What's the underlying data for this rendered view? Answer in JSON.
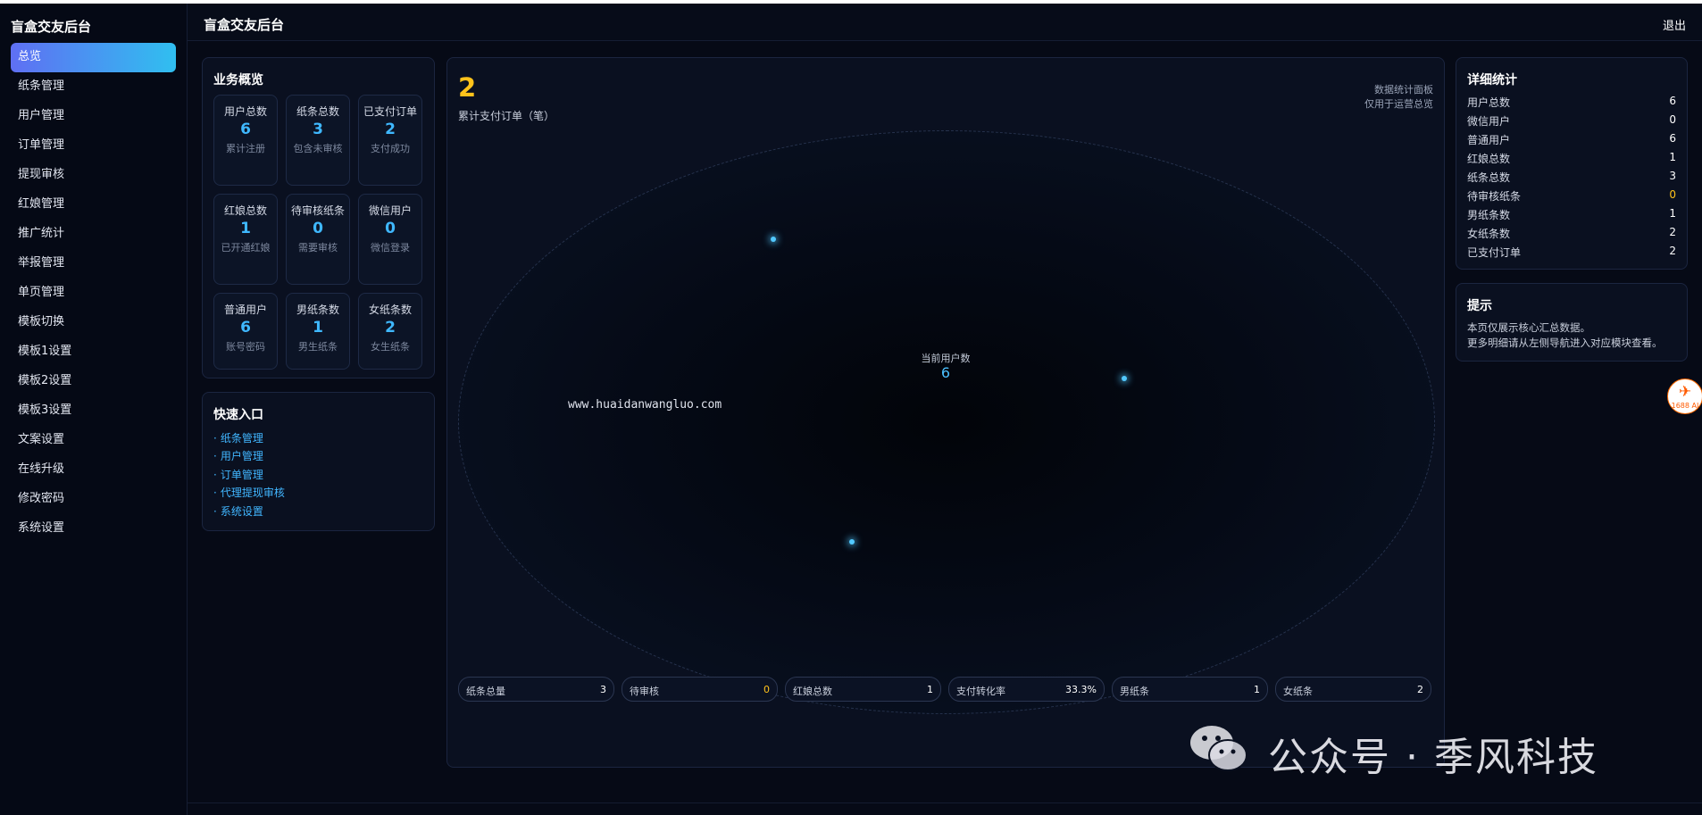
{
  "app": {
    "brand": "盲盒交友后台",
    "header_title": "盲盒交友后台",
    "logout": "退出"
  },
  "sidebar": {
    "items": [
      {
        "label": "总览",
        "active": true
      },
      {
        "label": "纸条管理"
      },
      {
        "label": "用户管理"
      },
      {
        "label": "订单管理"
      },
      {
        "label": "提现审核"
      },
      {
        "label": "红娘管理"
      },
      {
        "label": "推广统计"
      },
      {
        "label": "举报管理"
      },
      {
        "label": "单页管理"
      },
      {
        "label": "模板切换"
      },
      {
        "label": "模板1设置"
      },
      {
        "label": "模板2设置"
      },
      {
        "label": "模板3设置"
      },
      {
        "label": "文案设置"
      },
      {
        "label": "在线升级"
      },
      {
        "label": "修改密码"
      },
      {
        "label": "系统设置"
      }
    ]
  },
  "overview": {
    "title": "业务概览",
    "cards": [
      {
        "label": "用户总数",
        "value": "6",
        "sub": "累计注册"
      },
      {
        "label": "纸条总数",
        "value": "3",
        "sub": "包含未审核"
      },
      {
        "label": "已支付订单",
        "value": "2",
        "sub": "支付成功"
      },
      {
        "label": "红娘总数",
        "value": "1",
        "sub": "已开通红娘"
      },
      {
        "label": "待审核纸条",
        "value": "0",
        "sub": "需要审核"
      },
      {
        "label": "微信用户",
        "value": "0",
        "sub": "微信登录"
      },
      {
        "label": "普通用户",
        "value": "6",
        "sub": "账号密码"
      },
      {
        "label": "男纸条数",
        "value": "1",
        "sub": "男生纸条"
      },
      {
        "label": "女纸条数",
        "value": "2",
        "sub": "女生纸条"
      }
    ]
  },
  "quick": {
    "title": "快速入口",
    "links": [
      "纸条管理",
      "用户管理",
      "订单管理",
      "代理提现审核",
      "系统设置"
    ]
  },
  "center": {
    "big_value": "2",
    "big_caption": "累计支付订单（笔）",
    "tag_title": "数据统计面板",
    "tag_sub": "仅用于运营总览",
    "center_label": "当前用户数",
    "center_value": "6",
    "watermark": "www.huaidanwangluo.com",
    "chips": [
      {
        "label": "纸条总量",
        "value": "3"
      },
      {
        "label": "待审核",
        "value": "0",
        "warn": true
      },
      {
        "label": "红娘总数",
        "value": "1"
      },
      {
        "label": "支付转化率",
        "value": "33.3%"
      },
      {
        "label": "男纸条",
        "value": "1"
      },
      {
        "label": "女纸条",
        "value": "2"
      }
    ]
  },
  "details": {
    "title": "详细统计",
    "rows": [
      {
        "label": "用户总数",
        "value": "6"
      },
      {
        "label": "微信用户",
        "value": "0"
      },
      {
        "label": "普通用户",
        "value": "6"
      },
      {
        "label": "红娘总数",
        "value": "1"
      },
      {
        "label": "纸条总数",
        "value": "3"
      },
      {
        "label": "待审核纸条",
        "value": "0",
        "warn": true
      },
      {
        "label": "男纸条数",
        "value": "1"
      },
      {
        "label": "女纸条数",
        "value": "2"
      },
      {
        "label": "已支付订单",
        "value": "2"
      }
    ]
  },
  "tip": {
    "title": "提示",
    "line1": "本页仅展示核心汇总数据。",
    "line2": "更多明细请从左侧导航进入对应模块查看。"
  },
  "badges": {
    "ai_text": "1688 AI"
  },
  "overlay": {
    "wechat_text": "公众号 · 季风科技"
  },
  "icons": {
    "ai_badge": "1688-ai-icon",
    "wechat": "wechat-icon"
  },
  "colors": {
    "accent": "#3fb8ff",
    "warn": "#ffc21b",
    "bg": "#060a16",
    "nav_active_start": "#5f6ff3",
    "nav_active_end": "#30bff0"
  }
}
